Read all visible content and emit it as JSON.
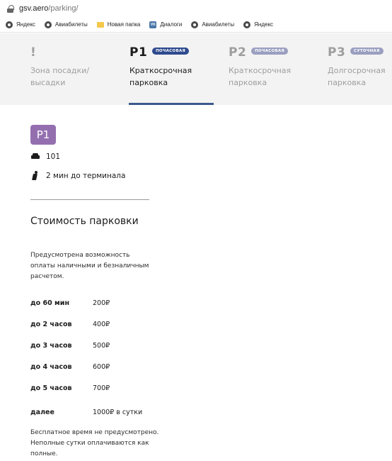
{
  "browser": {
    "url_host": "gsv.aero",
    "url_path": "/parking/",
    "bookmarks": [
      {
        "label": "Яндекс",
        "icon": "globe-icon"
      },
      {
        "label": "Авиабилеты",
        "icon": "globe-icon"
      },
      {
        "label": "Новая папка",
        "icon": "folder-icon"
      },
      {
        "label": "Диалоги",
        "icon": "vk-icon",
        "icon_text": "VK"
      },
      {
        "label": "Авиабилеты",
        "icon": "globe-icon"
      },
      {
        "label": "Яндекс",
        "icon": "globe-icon"
      }
    ]
  },
  "nav": {
    "items": [
      {
        "code": "!",
        "badge": "",
        "label_line1": "Зона посадки/",
        "label_line2": "высадки",
        "active": false
      },
      {
        "code": "P1",
        "badge": "ПОЧАСОВАЯ",
        "label_line1": "Краткосрочная",
        "label_line2": "парковка",
        "active": true
      },
      {
        "code": "P2",
        "badge": "ПОЧАСОВАЯ",
        "label_line1": "Краткосрочная",
        "label_line2": "парковка",
        "active": false
      },
      {
        "code": "P3",
        "badge": "СУТОЧНАЯ",
        "label_line1": "Долгосрочная",
        "label_line2": "парковка",
        "active": false
      }
    ]
  },
  "parking": {
    "code": "P1",
    "spaces": "101",
    "walk_time": "2 мин до терминала",
    "badge_color": "#946fb0"
  },
  "pricing": {
    "title": "Стоимость парковки",
    "description": "Предусмотрена возможность оплаты наличными и безналичным расчетом.",
    "rows": [
      {
        "duration": "до 60 мин",
        "price": "200₽"
      },
      {
        "duration": "до 2 часов",
        "price": "400₽"
      },
      {
        "duration": "до 3 часов",
        "price": "500₽"
      },
      {
        "duration": "до 4 часов",
        "price": "600₽"
      },
      {
        "duration": "до 5 часов",
        "price": "700₽"
      },
      {
        "duration": "далее",
        "price": "1000₽ в сутки"
      }
    ],
    "note": "Бесплатное время не предусмотрено. Неполные сутки оплачиваются как полные."
  },
  "colors": {
    "active_badge": "#2e4a8e",
    "inactive_badge": "#9a9fc0",
    "active_underline": "#3b5a8e"
  }
}
